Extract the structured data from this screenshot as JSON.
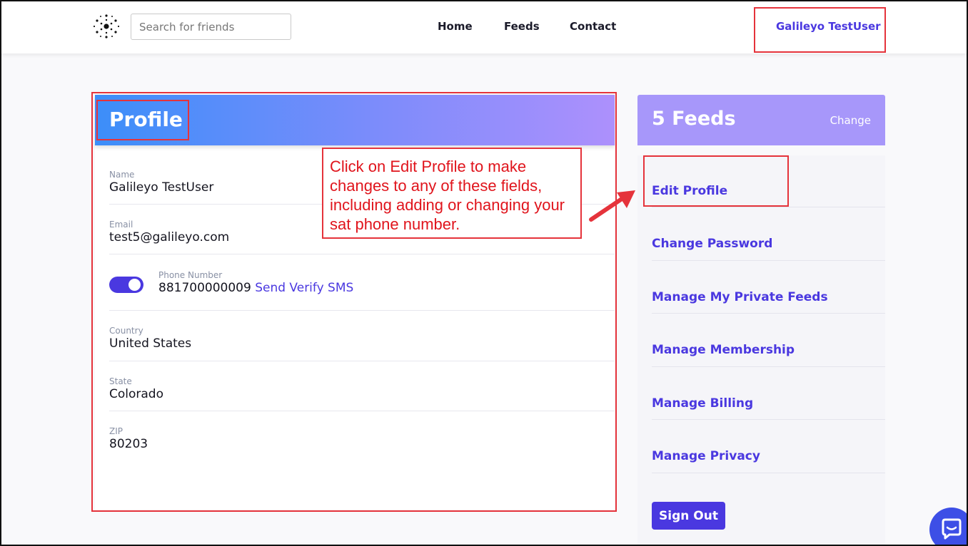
{
  "header": {
    "search_placeholder": "Search for friends",
    "nav": [
      "Home",
      "Feeds",
      "Contact"
    ],
    "user_name": "Galileyo TestUser"
  },
  "profile": {
    "title": "Profile",
    "fields": [
      {
        "label": "Name",
        "value": "Galileyo TestUser"
      },
      {
        "label": "Email",
        "value": "test5@galileyo.com"
      },
      {
        "label": "Country",
        "value": "United States"
      },
      {
        "label": "State",
        "value": "Colorado"
      },
      {
        "label": "ZIP",
        "value": "80203"
      }
    ],
    "phone": {
      "label": "Phone Number",
      "value": "881700000009",
      "verify_link": "Send Verify SMS",
      "toggle_on": true
    }
  },
  "callout": {
    "text": "Click on Edit Profile to make changes to any of these fields, including adding or changing your sat phone number."
  },
  "sidebar": {
    "feeds_title": "5 Feeds",
    "change_label": "Change",
    "menu": [
      "Edit Profile",
      "Change Password",
      "Manage My Private Feeds",
      "Manage Membership",
      "Manage Billing",
      "Manage Privacy"
    ],
    "signout_label": "Sign Out"
  },
  "colors": {
    "accent": "#4a38e0",
    "highlight": "#e5333b",
    "header_gradient_start": "#3c8ef9",
    "header_gradient_end": "#ad90fc",
    "sidebar_header": "#a797fa"
  },
  "icons": {
    "logo": "galileyo-logo-icon",
    "chat": "chat-bubble-icon",
    "arrow": "callout-arrow-icon"
  }
}
